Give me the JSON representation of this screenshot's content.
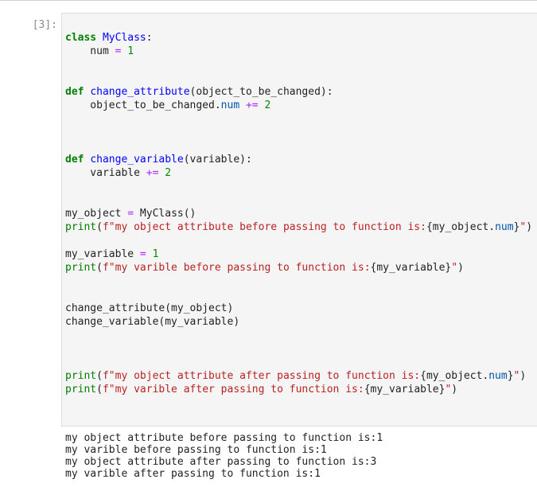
{
  "cell": {
    "prompt": "[3]:",
    "code_lines": [
      [
        [
          "class",
          "kw"
        ],
        [
          " ",
          "pl"
        ],
        [
          "MyClass",
          "def"
        ],
        [
          ":",
          "pl"
        ]
      ],
      [
        [
          "    num ",
          "pl"
        ],
        [
          "=",
          "op"
        ],
        [
          " ",
          "pl"
        ],
        [
          "1",
          "num"
        ]
      ],
      [],
      [],
      [
        [
          "def",
          "kw"
        ],
        [
          " ",
          "pl"
        ],
        [
          "change_attribute",
          "def"
        ],
        [
          "(object_to_be_changed):",
          "pl"
        ]
      ],
      [
        [
          "    object_to_be_changed.",
          "pl"
        ],
        [
          "num",
          "attr"
        ],
        [
          " ",
          "pl"
        ],
        [
          "+=",
          "op"
        ],
        [
          " ",
          "pl"
        ],
        [
          "2",
          "num"
        ]
      ],
      [],
      [],
      [],
      [
        [
          "def",
          "kw"
        ],
        [
          " ",
          "pl"
        ],
        [
          "change_variable",
          "def"
        ],
        [
          "(variable):",
          "pl"
        ]
      ],
      [
        [
          "    variable ",
          "pl"
        ],
        [
          "+=",
          "op"
        ],
        [
          " ",
          "pl"
        ],
        [
          "2",
          "num"
        ]
      ],
      [],
      [],
      [
        [
          "my_object ",
          "pl"
        ],
        [
          "=",
          "op"
        ],
        [
          " MyClass()",
          "pl"
        ]
      ],
      [
        [
          "print",
          "builtin"
        ],
        [
          "(",
          "pl"
        ],
        [
          "f\"my object attribute before passing to function is:",
          "str"
        ],
        [
          "{my_object.",
          "pl"
        ],
        [
          "num",
          "attr"
        ],
        [
          "}",
          "pl"
        ],
        [
          "\"",
          "str"
        ],
        [
          ")",
          "pl"
        ]
      ],
      [],
      [
        [
          "my_variable ",
          "pl"
        ],
        [
          "=",
          "op"
        ],
        [
          " ",
          "pl"
        ],
        [
          "1",
          "num"
        ]
      ],
      [
        [
          "print",
          "builtin"
        ],
        [
          "(",
          "pl"
        ],
        [
          "f\"my varible before passing to function is:",
          "str"
        ],
        [
          "{my_variable}",
          "pl"
        ],
        [
          "\"",
          "str"
        ],
        [
          ")",
          "pl"
        ]
      ],
      [],
      [],
      [
        [
          "change_attribute(my_object)",
          "pl"
        ]
      ],
      [
        [
          "change_variable(my_variable)",
          "pl"
        ]
      ],
      [],
      [],
      [],
      [
        [
          "print",
          "builtin"
        ],
        [
          "(",
          "pl"
        ],
        [
          "f\"my object attribute after passing to function is:",
          "str"
        ],
        [
          "{my_object.",
          "pl"
        ],
        [
          "num",
          "attr"
        ],
        [
          "}",
          "pl"
        ],
        [
          "\"",
          "str"
        ],
        [
          ")",
          "pl"
        ]
      ],
      [
        [
          "print",
          "builtin"
        ],
        [
          "(",
          "pl"
        ],
        [
          "f\"my varible after passing to function is:",
          "str"
        ],
        [
          "{my_variable}",
          "pl"
        ],
        [
          "\"",
          "str"
        ],
        [
          ")",
          "pl"
        ]
      ]
    ],
    "output_lines": [
      "my object attribute before passing to function is:1",
      "my varible before passing to function is:1",
      "my object attribute after passing to function is:3",
      "my varible after passing to function is:1"
    ]
  },
  "colors": {
    "kw": "#008000",
    "def": "#0000ff",
    "builtin": "#008000",
    "str": "#ba2121",
    "num": "#008800",
    "op": "#aa22ff",
    "attr": "#0055aa",
    "pl": "#222222"
  }
}
